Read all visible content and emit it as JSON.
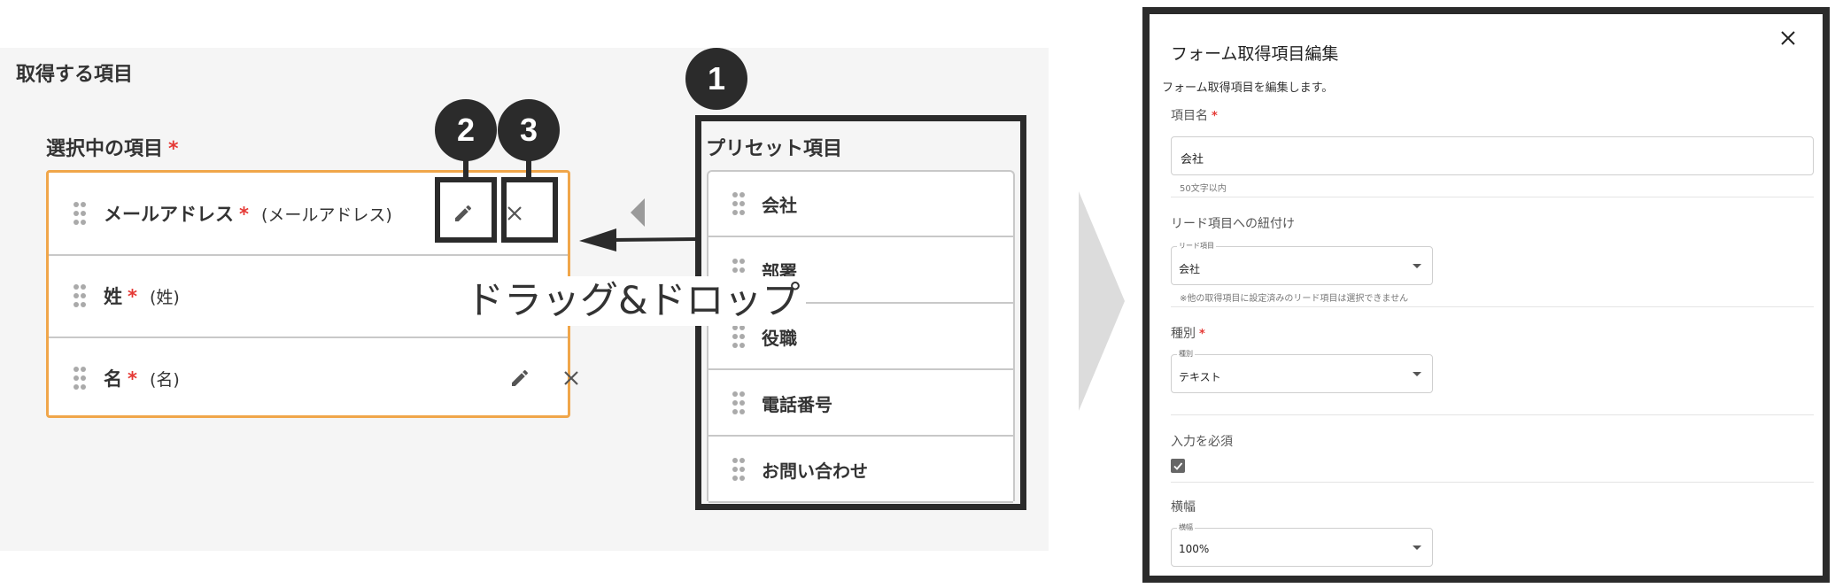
{
  "left": {
    "section_title": "取得する項目",
    "selected_label": "選択中の項目",
    "required_mark": "*",
    "rows": [
      {
        "name": "メールアドレス",
        "sub": "(メールアドレス)"
      },
      {
        "name": "姓",
        "sub": "(姓)"
      },
      {
        "name": "名",
        "sub": "(名)"
      }
    ]
  },
  "callouts": {
    "one": "1",
    "two": "2",
    "three": "3"
  },
  "preset": {
    "title": "プリセット項目",
    "items": [
      "会社",
      "部署",
      "役職",
      "電話番号",
      "お問い合わせ"
    ]
  },
  "drag_drop_label": "ドラッグ&ドロップ",
  "modal": {
    "title": "フォーム取得項目編集",
    "description": "フォーム取得項目を編集します。",
    "name_label": "項目名",
    "name_value": "会社",
    "name_hint": "50文字以内",
    "lead_label": "リード項目への紐付け",
    "lead_legend": "リード項目",
    "lead_value": "会社",
    "lead_hint": "※他の取得項目に設定済みのリード項目は選択できません",
    "type_label": "種別",
    "type_legend": "種別",
    "type_value": "テキスト",
    "required_label": "入力を必須",
    "required_checked": true,
    "width_label": "横幅",
    "width_legend": "横幅",
    "width_value": "100%"
  },
  "colors": {
    "accent_border": "#f0a64a",
    "required": "#e53935",
    "callout": "#2b2b2b"
  },
  "icons": [
    "drag-handle-icon",
    "pencil-icon",
    "close-icon",
    "arrow-left-icon",
    "chevron-down-icon",
    "check-icon"
  ]
}
